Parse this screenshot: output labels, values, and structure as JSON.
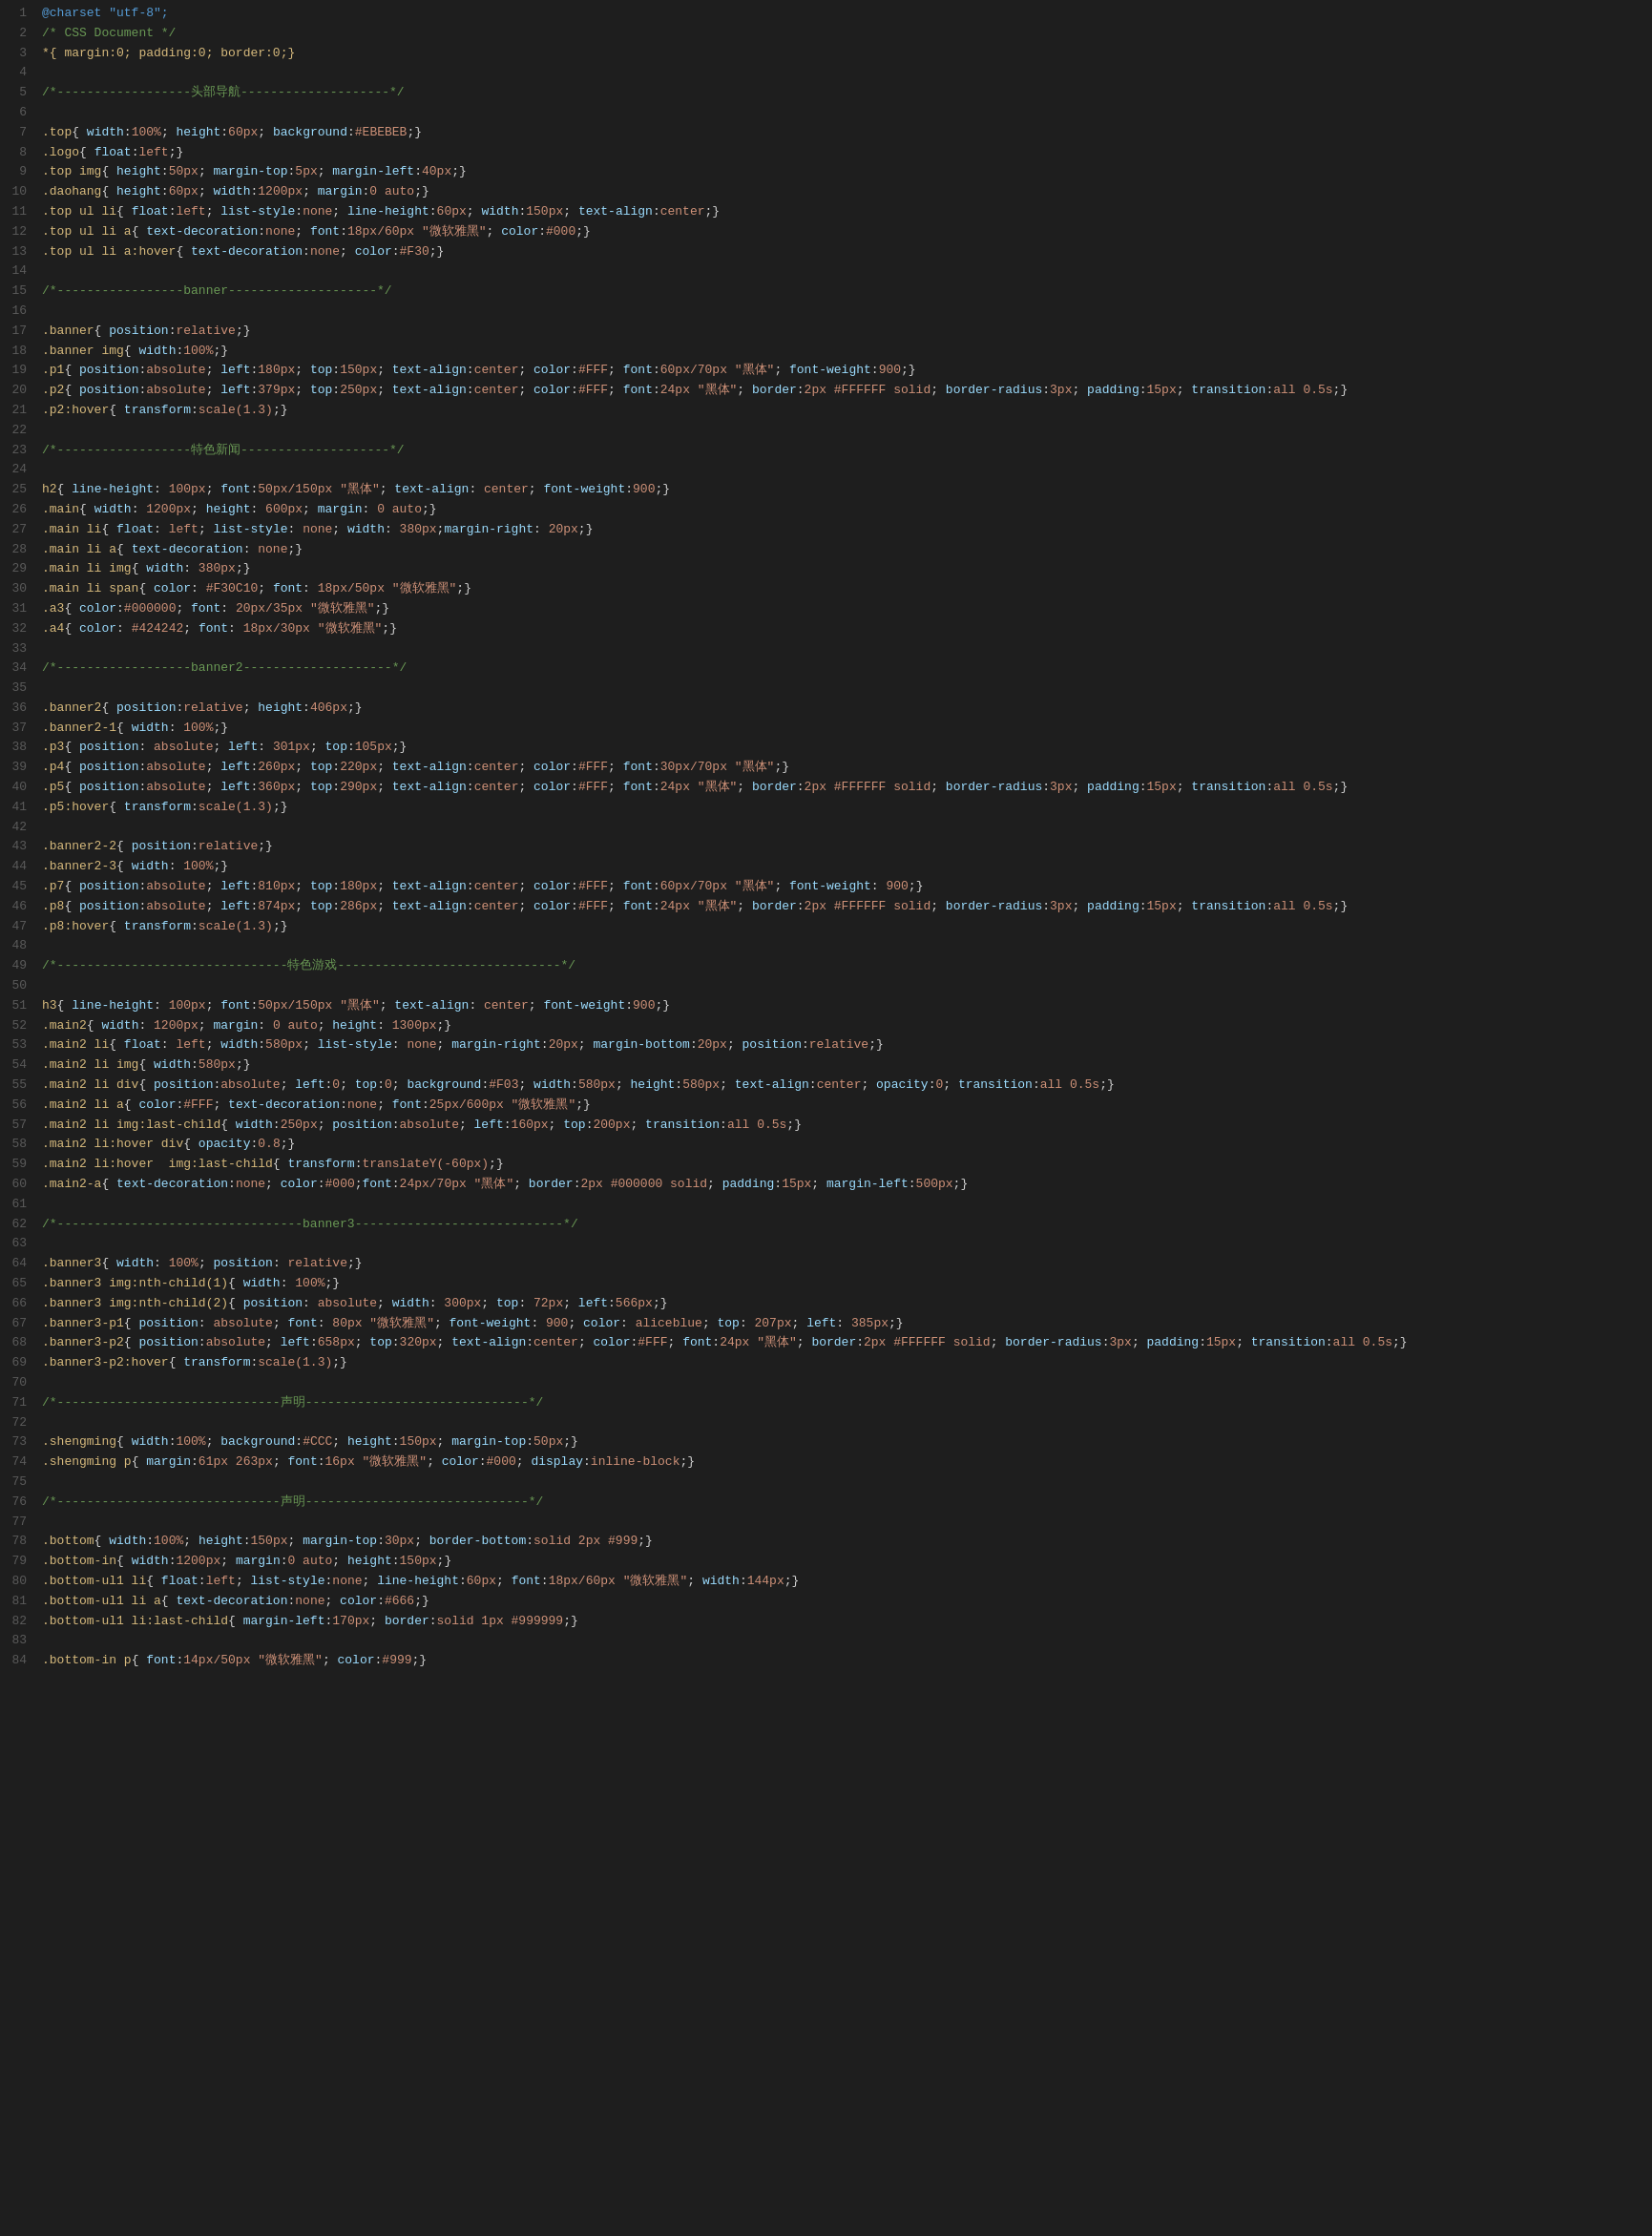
{
  "title": "CSS Document",
  "lines": [
    {
      "num": 1,
      "tokens": [
        {
          "t": "@charset \"utf-8\";",
          "c": "c-at"
        }
      ]
    },
    {
      "num": 2,
      "tokens": [
        {
          "t": "/* CSS Document */",
          "c": "c-comment"
        }
      ]
    },
    {
      "num": 3,
      "tokens": [
        {
          "t": "*{ margin:0; padding:0; border:0;}",
          "c": "c-selector"
        }
      ]
    },
    {
      "num": 4,
      "tokens": [
        {
          "t": "",
          "c": ""
        }
      ]
    },
    {
      "num": 5,
      "tokens": [
        {
          "t": "/*------------------头部导航--------------------*/",
          "c": "c-comment"
        }
      ]
    },
    {
      "num": 6,
      "tokens": [
        {
          "t": "",
          "c": ""
        }
      ]
    },
    {
      "num": 7,
      "tokens": [
        {
          "t": ".top{ width:100%; height:60px; background:#EBEBEB;}",
          "c": "c-selector"
        }
      ]
    },
    {
      "num": 8,
      "tokens": [
        {
          "t": ".logo{ float:left;}",
          "c": "c-selector"
        }
      ]
    },
    {
      "num": 9,
      "tokens": [
        {
          "t": ".top img{ height:50px; margin-top:5px; margin-left:40px;}",
          "c": "c-selector"
        }
      ]
    },
    {
      "num": 10,
      "tokens": [
        {
          "t": ".daohang{ height:60px; width:1200px; margin:0 auto;}",
          "c": "c-selector"
        }
      ]
    },
    {
      "num": 11,
      "tokens": [
        {
          "t": ".top ul li{ float:left; list-style:none; line-height:60px; width:150px; text-align:center;}",
          "c": "c-selector"
        }
      ]
    },
    {
      "num": 12,
      "tokens": [
        {
          "t": ".top ul li a{ text-decoration:none; font:18px/60px \"微软雅黑\"; color:#000;}",
          "c": "c-selector"
        }
      ]
    },
    {
      "num": 13,
      "tokens": [
        {
          "t": ".top ul li a:hover{ text-decoration:none; color:#F30;}",
          "c": "c-selector"
        }
      ]
    },
    {
      "num": 14,
      "tokens": [
        {
          "t": "",
          "c": ""
        }
      ]
    },
    {
      "num": 15,
      "tokens": [
        {
          "t": "/*-----------------banner--------------------*/",
          "c": "c-comment"
        }
      ]
    },
    {
      "num": 16,
      "tokens": [
        {
          "t": "",
          "c": ""
        }
      ]
    },
    {
      "num": 17,
      "tokens": [
        {
          "t": ".banner{ position:relative;}",
          "c": "c-selector"
        }
      ]
    },
    {
      "num": 18,
      "tokens": [
        {
          "t": ".banner img{ width:100%;}",
          "c": "c-selector"
        }
      ]
    },
    {
      "num": 19,
      "tokens": [
        {
          "t": ".p1{ position:absolute; left:180px; top:150px; text-align:center; color:#FFF; font:60px/70px \"黑体\"; font-weight:900; }",
          "c": "c-selector"
        }
      ]
    },
    {
      "num": 20,
      "tokens": [
        {
          "t": ".p2{ position:absolute; left:379px; top:250px; text-align:center; color:#FFF; font:24px \"黑体\"; border:2px #FFFFFF solid; border-radius:3px; padding:15px; transition:all 0.5s;}",
          "c": "c-selector"
        }
      ]
    },
    {
      "num": 21,
      "tokens": [
        {
          "t": ".p2:hover{ transform:scale(1.3);}",
          "c": "c-selector"
        }
      ]
    },
    {
      "num": 22,
      "tokens": [
        {
          "t": "",
          "c": ""
        }
      ]
    },
    {
      "num": 23,
      "tokens": [
        {
          "t": "/*------------------特色新闻--------------------*/",
          "c": "c-comment"
        }
      ]
    },
    {
      "num": 24,
      "tokens": [
        {
          "t": "",
          "c": ""
        }
      ]
    },
    {
      "num": 25,
      "tokens": [
        {
          "t": "h2{ line-height: 100px; font:50px/150px \"黑体\"; text-align: center; font-weight:900;}",
          "c": "c-selector"
        }
      ]
    },
    {
      "num": 26,
      "tokens": [
        {
          "t": ".main{ width: 1200px; height: 600px; margin: 0 auto;}",
          "c": "c-selector"
        }
      ]
    },
    {
      "num": 27,
      "tokens": [
        {
          "t": ".main li{ float: left; list-style: none; width: 380px;margin-right: 20px;}",
          "c": "c-selector"
        }
      ]
    },
    {
      "num": 28,
      "tokens": [
        {
          "t": ".main li a{ text-decoration: none;}",
          "c": "c-selector"
        }
      ]
    },
    {
      "num": 29,
      "tokens": [
        {
          "t": ".main li img{ width: 380px;}",
          "c": "c-selector"
        }
      ]
    },
    {
      "num": 30,
      "tokens": [
        {
          "t": ".main li span{ color: #F30C10; font: 18px/50px \"微软雅黑\";}",
          "c": "c-selector"
        }
      ]
    },
    {
      "num": 31,
      "tokens": [
        {
          "t": ".a3{ color:#000000; font: 20px/35px \"微软雅黑\";}",
          "c": "c-selector"
        }
      ]
    },
    {
      "num": 32,
      "tokens": [
        {
          "t": ".a4{ color: #424242; font: 18px/30px \"微软雅黑\";}",
          "c": "c-selector"
        }
      ]
    },
    {
      "num": 33,
      "tokens": [
        {
          "t": "",
          "c": ""
        }
      ]
    },
    {
      "num": 34,
      "tokens": [
        {
          "t": "/*------------------banner2--------------------*/",
          "c": "c-comment"
        }
      ]
    },
    {
      "num": 35,
      "tokens": [
        {
          "t": "",
          "c": ""
        }
      ]
    },
    {
      "num": 36,
      "tokens": [
        {
          "t": ".banner2{ position:relative; height:406px;}",
          "c": "c-selector"
        }
      ]
    },
    {
      "num": 37,
      "tokens": [
        {
          "t": ".banner2-1{ width: 100%;}",
          "c": "c-selector"
        }
      ]
    },
    {
      "num": 38,
      "tokens": [
        {
          "t": ".p3{ position: absolute; left: 301px; top:105px;}",
          "c": "c-selector"
        }
      ]
    },
    {
      "num": 39,
      "tokens": [
        {
          "t": ".p4{ position:absolute; left:260px; top:220px; text-align:center; color:#FFF; font:30px/70px \"黑体\";  }",
          "c": "c-selector"
        }
      ]
    },
    {
      "num": 40,
      "tokens": [
        {
          "t": ".p5{ position:absolute; left:360px; top:290px; text-align:center; color:#FFF; font:24px \"黑体\"; border:2px #FFFFFF solid; border-radius:3px; padding:15px; transition:all 0.5s;}",
          "c": "c-selector"
        }
      ]
    },
    {
      "num": 41,
      "tokens": [
        {
          "t": ".p5:hover{ transform:scale(1.3);}",
          "c": "c-selector"
        }
      ]
    },
    {
      "num": 42,
      "tokens": [
        {
          "t": "",
          "c": ""
        }
      ]
    },
    {
      "num": 43,
      "tokens": [
        {
          "t": ".banner2-2{ position:relative;}",
          "c": "c-selector"
        }
      ]
    },
    {
      "num": 44,
      "tokens": [
        {
          "t": ".banner2-3{ width: 100%;}",
          "c": "c-selector"
        }
      ]
    },
    {
      "num": 45,
      "tokens": [
        {
          "t": ".p7{ position:absolute; left:810px; top:180px; text-align:center; color:#FFF; font:60px/70px \"黑体\"; font-weight: 900;}",
          "c": "c-selector"
        }
      ]
    },
    {
      "num": 46,
      "tokens": [
        {
          "t": ".p8{ position:absolute; left:874px; top:286px; text-align:center; color:#FFF; font:24px \"黑体\"; border:2px #FFFFFF solid; border-radius:3px; padding:15px; transition:all 0.5s;}",
          "c": "c-selector"
        }
      ]
    },
    {
      "num": 47,
      "tokens": [
        {
          "t": ".p8:hover{ transform:scale(1.3);}",
          "c": "c-selector"
        }
      ]
    },
    {
      "num": 48,
      "tokens": [
        {
          "t": "",
          "c": ""
        }
      ]
    },
    {
      "num": 49,
      "tokens": [
        {
          "t": "/*-------------------------------特色游戏------------------------------*/",
          "c": "c-comment"
        }
      ]
    },
    {
      "num": 50,
      "tokens": [
        {
          "t": "",
          "c": ""
        }
      ]
    },
    {
      "num": 51,
      "tokens": [
        {
          "t": "h3{ line-height: 100px; font:50px/150px \"黑体\"; text-align: center; font-weight:900;}",
          "c": "c-selector"
        }
      ]
    },
    {
      "num": 52,
      "tokens": [
        {
          "t": ".main2{ width: 1200px; margin: 0 auto; height: 1300px;}",
          "c": "c-selector"
        }
      ]
    },
    {
      "num": 53,
      "tokens": [
        {
          "t": ".main2 li{ float: left; width:580px; list-style: none; margin-right:20px; margin-bottom:20px; position:relative;}",
          "c": "c-selector"
        }
      ]
    },
    {
      "num": 54,
      "tokens": [
        {
          "t": ".main2 li img{ width:580px;}",
          "c": "c-selector"
        }
      ]
    },
    {
      "num": 55,
      "tokens": [
        {
          "t": ".main2 li div{ position:absolute; left:0; top:0; background:#F03; width:580px; height:580px; text-align:center; opacity:0; transition:all 0.5s;}",
          "c": "c-selector"
        }
      ]
    },
    {
      "num": 56,
      "tokens": [
        {
          "t": ".main2 li a{ color:#FFF; text-decoration:none; font:25px/600px \"微软雅黑\";}",
          "c": "c-selector"
        }
      ]
    },
    {
      "num": 57,
      "tokens": [
        {
          "t": ".main2 li img:last-child{ width:250px; position:absolute; left:160px; top:200px; transition:all 0.5s;}",
          "c": "c-selector"
        }
      ]
    },
    {
      "num": 58,
      "tokens": [
        {
          "t": ".main2 li:hover div{ opacity:0.8;}",
          "c": "c-selector"
        }
      ]
    },
    {
      "num": 59,
      "tokens": [
        {
          "t": ".main2 li:hover  img:last-child{ transform:translateY(-60px);}",
          "c": "c-selector"
        }
      ]
    },
    {
      "num": 60,
      "tokens": [
        {
          "t": ".main2-a{ text-decoration:none; color:#000;font:24px/70px \"黑体\"; border:2px #000000 solid; padding:15px; margin-left:500px;}",
          "c": "c-selector"
        }
      ]
    },
    {
      "num": 61,
      "tokens": [
        {
          "t": "",
          "c": ""
        }
      ]
    },
    {
      "num": 62,
      "tokens": [
        {
          "t": "/*---------------------------------banner3----------------------------*/",
          "c": "c-comment"
        }
      ]
    },
    {
      "num": 63,
      "tokens": [
        {
          "t": "",
          "c": ""
        }
      ]
    },
    {
      "num": 64,
      "tokens": [
        {
          "t": ".banner3{ width: 100%; position: relative;}",
          "c": "c-selector"
        }
      ]
    },
    {
      "num": 65,
      "tokens": [
        {
          "t": ".banner3 img:nth-child(1){ width: 100%;}",
          "c": "c-selector"
        }
      ]
    },
    {
      "num": 66,
      "tokens": [
        {
          "t": ".banner3 img:nth-child(2){ position: absolute; width: 300px; top: 72px; left:566px; }",
          "c": "c-selector"
        }
      ]
    },
    {
      "num": 67,
      "tokens": [
        {
          "t": ".banner3-p1{ position: absolute; font: 80px \"微软雅黑\"; font-weight: 900; color: aliceblue; top: 207px; left: 385px;}",
          "c": "c-selector"
        }
      ]
    },
    {
      "num": 68,
      "tokens": [
        {
          "t": ".banner3-p2{ position:absolute; left:658px; top:320px; text-align:center; color:#FFF; font:24px \"黑体\"; border:2px #FFFFFF solid; border-radius:3px; padding:15px; transition:all 0.5s;}",
          "c": "c-selector"
        }
      ]
    },
    {
      "num": 69,
      "tokens": [
        {
          "t": ".banner3-p2:hover{ transform:scale(1.3);}",
          "c": "c-selector"
        }
      ]
    },
    {
      "num": 70,
      "tokens": [
        {
          "t": "",
          "c": ""
        }
      ]
    },
    {
      "num": 71,
      "tokens": [
        {
          "t": "/*------------------------------声明------------------------------*/",
          "c": "c-comment"
        }
      ]
    },
    {
      "num": 72,
      "tokens": [
        {
          "t": "",
          "c": ""
        }
      ]
    },
    {
      "num": 73,
      "tokens": [
        {
          "t": ".shengming{ width:100%; background:#CCC; height:150px; margin-top:50px;}",
          "c": "c-selector"
        }
      ]
    },
    {
      "num": 74,
      "tokens": [
        {
          "t": ".shengming p{ margin:61px 263px; font:16px \"微软雅黑\"; color:#000; display:inline-block;}",
          "c": "c-selector"
        }
      ]
    },
    {
      "num": 75,
      "tokens": [
        {
          "t": "",
          "c": ""
        }
      ]
    },
    {
      "num": 76,
      "tokens": [
        {
          "t": "/*------------------------------声明------------------------------*/",
          "c": "c-comment"
        }
      ]
    },
    {
      "num": 77,
      "tokens": [
        {
          "t": "",
          "c": ""
        }
      ]
    },
    {
      "num": 78,
      "tokens": [
        {
          "t": ".bottom{ width:100%; height:150px; margin-top:30px; border-bottom:solid 2px #999;}",
          "c": "c-selector"
        }
      ]
    },
    {
      "num": 79,
      "tokens": [
        {
          "t": ".bottom-in{ width:1200px; margin:0 auto; height:150px;}",
          "c": "c-selector"
        }
      ]
    },
    {
      "num": 80,
      "tokens": [
        {
          "t": ".bottom-ul1 li{ float:left; list-style:none; line-height:60px; font:18px/60px \"微软雅黑\"; width:144px;}",
          "c": "c-selector"
        }
      ]
    },
    {
      "num": 81,
      "tokens": [
        {
          "t": ".bottom-ul1 li a{ text-decoration:none; color:#666; }",
          "c": "c-selector"
        }
      ]
    },
    {
      "num": 82,
      "tokens": [
        {
          "t": ".bottom-ul1 li:last-child{ margin-left:170px; border:solid 1px #999999;}",
          "c": "c-selector"
        }
      ]
    },
    {
      "num": 83,
      "tokens": [
        {
          "t": "",
          "c": ""
        }
      ]
    },
    {
      "num": 84,
      "tokens": [
        {
          "t": ".bottom-in p{ font:14px/50px \"微软雅黑\"; color:#999;}",
          "c": "c-selector"
        }
      ]
    }
  ]
}
